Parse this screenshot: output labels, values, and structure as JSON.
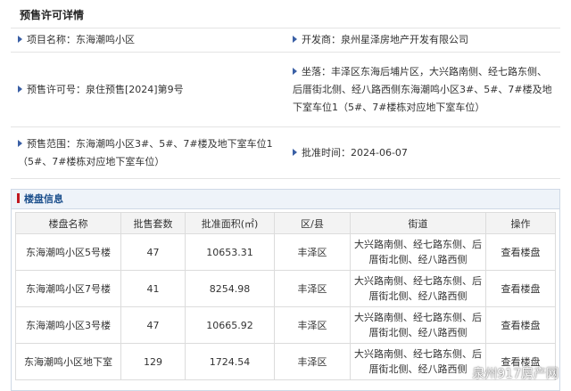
{
  "presale": {
    "title": "预售许可详情",
    "rows": [
      [
        "项目名称：东海潮鸣小区",
        "开发商：泉州星泽房地产开发有限公司"
      ],
      [
        "预售许可号：泉住预售[2024]第9号",
        "坐落：丰泽区东海后埔片区，大兴路南侧、经七路东侧、后厝街北侧、经八路西侧东海潮鸣小区3#、5#、7#楼及地下室车位1（5#、7#楼栋对应地下室车位）"
      ],
      [
        "预售范围：东海潮鸣小区3#、5#、7#楼及地下室车位1（5#、7#楼栋对应地下室车位）",
        "批准时间：2024-06-07"
      ]
    ]
  },
  "listing": {
    "title": "楼盘信息",
    "columns": [
      "楼盘名称",
      "批售套数",
      "批准面积(㎡)",
      "区/县",
      "街道",
      "操作"
    ],
    "rows": [
      {
        "name": "东海潮鸣小区5号楼",
        "count": "47",
        "area": "10653.31",
        "district": "丰泽区",
        "street": "大兴路南侧、经七路东侧、后厝街北侧、经八路西侧",
        "action": "查看楼盘"
      },
      {
        "name": "东海潮鸣小区7号楼",
        "count": "41",
        "area": "8254.98",
        "district": "丰泽区",
        "street": "大兴路南侧、经七路东侧、后厝街北侧、经八路西侧",
        "action": "查看楼盘"
      },
      {
        "name": "东海潮鸣小区3号楼",
        "count": "47",
        "area": "10665.92",
        "district": "丰泽区",
        "street": "大兴路南侧、经七路东侧、后厝街北侧、经八路西侧",
        "action": "查看楼盘"
      },
      {
        "name": "东海潮鸣小区地下室",
        "count": "129",
        "area": "1724.54",
        "district": "丰泽区",
        "street": "大兴路南侧、经七路东侧、后厝街北侧、经八路西侧",
        "action": "查看楼盘"
      }
    ]
  },
  "watermark": "泉州917房产网",
  "colors": {
    "accent": "#1b4f8c",
    "marker": "#c0181f"
  }
}
